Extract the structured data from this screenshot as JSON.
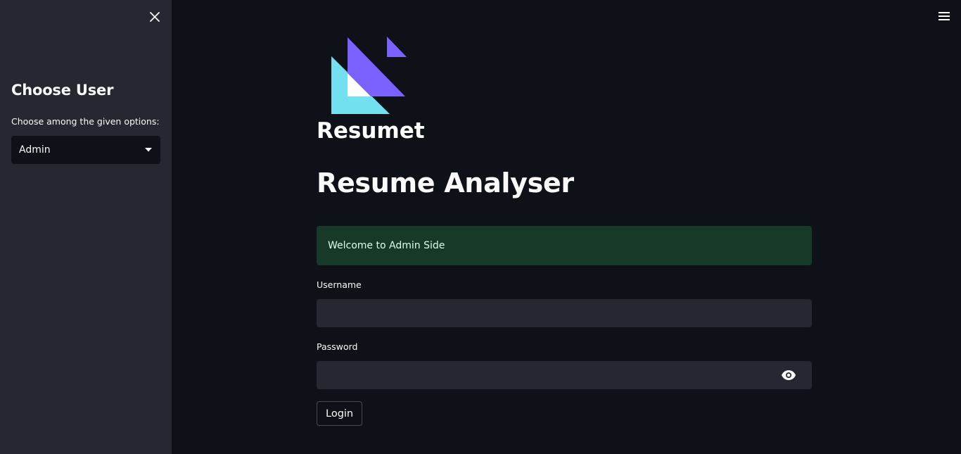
{
  "sidebar": {
    "title": "Choose User",
    "select_label": "Choose among the given options:",
    "selected_option": "Admin",
    "close_icon": "close-icon",
    "dropdown_icon": "caret-down-icon"
  },
  "header": {
    "menu_icon": "hamburger-menu-icon"
  },
  "logo": {
    "text": "Resumet",
    "colors": {
      "purple": "#7b61ff",
      "cyan": "#72e0ee",
      "white": "#ffffff"
    }
  },
  "main": {
    "title": "Resume Analyser",
    "alert_text": "Welcome to Admin Side",
    "username_label": "Username",
    "username_value": "",
    "password_label": "Password",
    "password_value": "",
    "password_toggle_icon": "eye-icon",
    "login_label": "Login"
  },
  "colors": {
    "app_background": "#0e1117",
    "sidebar_background": "#262730",
    "input_background": "#262730",
    "alert_background": "#173928",
    "alert_text": "#dffde9"
  }
}
